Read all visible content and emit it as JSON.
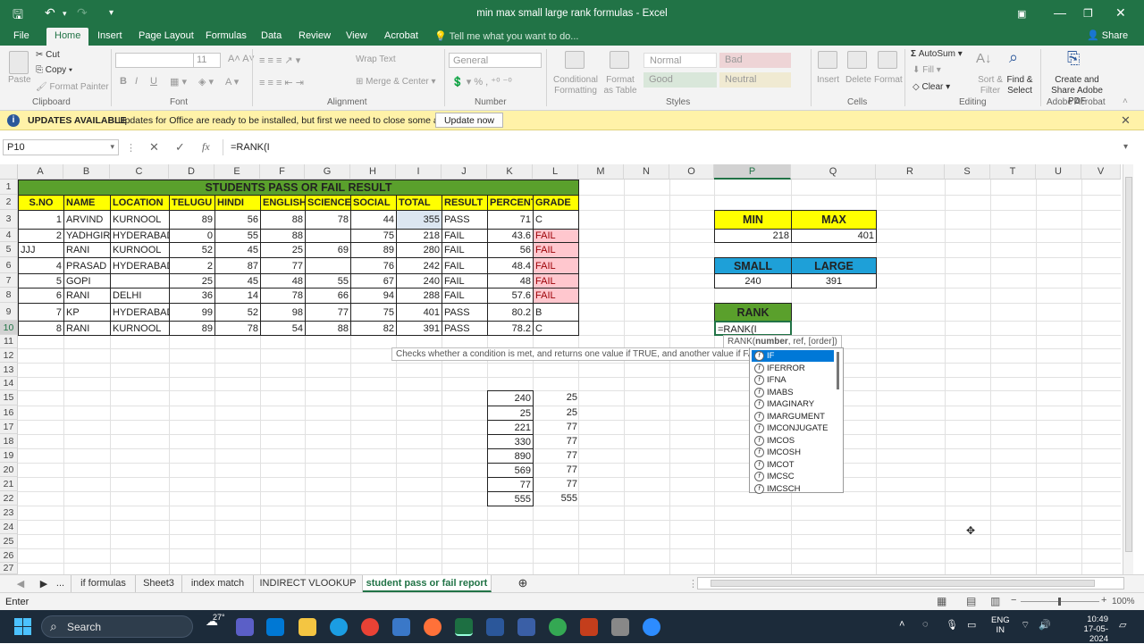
{
  "titlebar": {
    "title": "min max small large rank formulas - Excel",
    "undo": "↶",
    "redo": "↷"
  },
  "tabs": [
    "File",
    "Home",
    "Insert",
    "Page Layout",
    "Formulas",
    "Data",
    "Review",
    "View",
    "Acrobat"
  ],
  "tell_me": "Tell me what you want to do...",
  "share": "Share",
  "ribbon": {
    "paste": "Paste",
    "cut": "Cut",
    "copy": "Copy",
    "format_painter": "Format Painter",
    "font_size": "11",
    "wrap_text": "Wrap Text",
    "merge_center": "Merge & Center",
    "number_format": "General",
    "cond_format": "Conditional Formatting",
    "format_as_table": "Format as Table",
    "styles": [
      "Normal",
      "Bad",
      "Good",
      "Neutral"
    ],
    "insert": "Insert",
    "delete": "Delete",
    "format": "Format",
    "autosum": "AutoSum",
    "fill": "Fill",
    "clear": "Clear",
    "sort_filter": "Sort & Filter",
    "find_select": "Find & Select",
    "create_share": "Create and Share Adobe PDF",
    "groups": [
      "Clipboard",
      "Font",
      "Alignment",
      "Number",
      "Styles",
      "Cells",
      "Editing",
      "Adobe Acrobat"
    ]
  },
  "message_bar": {
    "title": "UPDATES AVAILABLE",
    "text": "Updates for Office are ready to be installed, but first we need to close some apps.",
    "button": "Update now"
  },
  "formula_bar": {
    "name_box": "P10",
    "formula": "=RANK(I"
  },
  "columns": [
    "A",
    "B",
    "C",
    "D",
    "E",
    "F",
    "G",
    "H",
    "I",
    "J",
    "K",
    "L",
    "M",
    "N",
    "O",
    "P",
    "Q",
    "R",
    "S",
    "T",
    "U",
    "V"
  ],
  "rows": [
    "1",
    "2",
    "3",
    "4",
    "5",
    "6",
    "7",
    "8",
    "9",
    "10",
    "11",
    "12",
    "13",
    "14",
    "15",
    "16",
    "17",
    "18",
    "19",
    "20",
    "21",
    "22",
    "23",
    "24",
    "25",
    "26",
    "27"
  ],
  "table": {
    "title": "STUDENTS PASS OR FAIL RESULT",
    "headers": [
      "S.NO",
      "NAME",
      "LOCATION",
      "TELUGU",
      "HINDI",
      "ENGLISH",
      "SCIENCE",
      "SOCIAL",
      "TOTAL",
      "RESULT",
      "PERCENTA",
      "GRADE"
    ],
    "rows": [
      [
        "1",
        "ARVIND",
        "KURNOOL",
        "89",
        "56",
        "88",
        "78",
        "44",
        "355",
        "PASS",
        "71",
        "C"
      ],
      [
        "2",
        "YADHGIRI",
        "HYDERABAD",
        "0",
        "55",
        "88",
        "",
        "75",
        "218",
        "FAIL",
        "43.6",
        "FAIL"
      ],
      [
        "JJJ",
        "RANI",
        "KURNOOL",
        "52",
        "45",
        "25",
        "69",
        "89",
        "280",
        "FAIL",
        "56",
        "FAIL"
      ],
      [
        "4",
        "PRASAD",
        "HYDERABAD",
        "2",
        "87",
        "77",
        "",
        "76",
        "242",
        "FAIL",
        "48.4",
        "FAIL"
      ],
      [
        "5",
        "GOPI",
        "",
        "25",
        "45",
        "48",
        "55",
        "67",
        "240",
        "FAIL",
        "48",
        "FAIL"
      ],
      [
        "6",
        "RANI",
        "DELHI",
        "36",
        "14",
        "78",
        "66",
        "94",
        "288",
        "FAIL",
        "57.6",
        "FAIL"
      ],
      [
        "7",
        "KP",
        "HYDERABAD",
        "99",
        "52",
        "98",
        "77",
        "75",
        "401",
        "PASS",
        "80.2",
        "B"
      ],
      [
        "8",
        "RANI",
        "KURNOOL",
        "89",
        "78",
        "54",
        "88",
        "82",
        "391",
        "PASS",
        "78.2",
        "C"
      ]
    ]
  },
  "summary": {
    "min_label": "MIN",
    "max_label": "MAX",
    "min": "218",
    "max": "401",
    "small_label": "SMALL",
    "large_label": "LARGE",
    "small": "240",
    "large": "391",
    "rank_label": "RANK",
    "rank_edit": "=RANK(I"
  },
  "side_list": [
    [
      "240",
      "25"
    ],
    [
      "25",
      "25"
    ],
    [
      "221",
      "77"
    ],
    [
      "330",
      "77"
    ],
    [
      "890",
      "77"
    ],
    [
      "569",
      "77"
    ],
    [
      "77",
      "77"
    ],
    [
      "555",
      "555"
    ]
  ],
  "hint": {
    "func": "RANK(",
    "arg1": "number",
    "rest": ", ref, [order])"
  },
  "tooltip": "Checks whether a condition is met, and returns one value if TRUE, and another value if FALSE",
  "autocomplete": [
    "IF",
    "IFERROR",
    "IFNA",
    "IMABS",
    "IMAGINARY",
    "IMARGUMENT",
    "IMCONJUGATE",
    "IMCOS",
    "IMCOSH",
    "IMCOT",
    "IMCSC",
    "IMCSCH"
  ],
  "sheets": [
    "...",
    "if formulas",
    "Sheet3",
    "index match",
    "INDIRECT VLOOKUP",
    "student pass or fail report"
  ],
  "status": {
    "mode": "Enter",
    "zoom": "100%"
  },
  "taskbar": {
    "search": "Search",
    "weather": "27°",
    "lang1": "ENG",
    "lang2": "IN",
    "time": "10:49",
    "date": "17-05-2024"
  },
  "colors": {
    "excel_green": "#217346",
    "title_fill": "#5aa02c",
    "header_fill": "#ffff00",
    "fail_fill": "#ffc7ce",
    "fail_text": "#9c0006",
    "small_fill": "#1ea0d8",
    "rank_fill": "#5aa02c"
  }
}
